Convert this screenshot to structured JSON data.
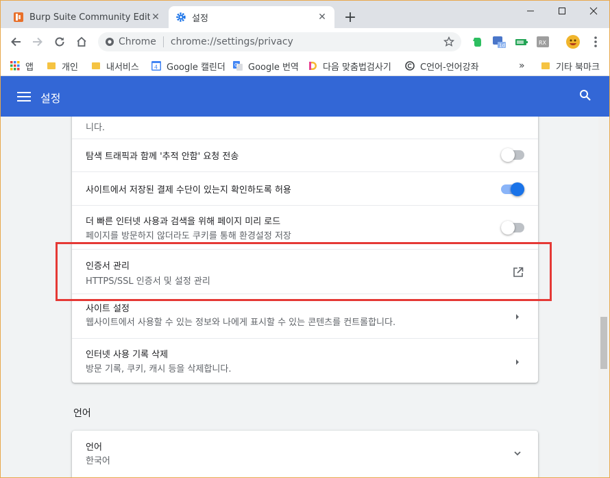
{
  "tabs": [
    {
      "title": "Burp Suite Community Edition",
      "icon": "burp-icon"
    },
    {
      "title": "설정",
      "icon": "gear-icon"
    }
  ],
  "toolbar": {
    "omnibox_label": "Chrome",
    "url": "chrome://settings/privacy"
  },
  "bookmarks": [
    {
      "label": "앱",
      "icon": "apps-icon"
    },
    {
      "label": "개인",
      "icon": "folder-icon"
    },
    {
      "label": "내서비스",
      "icon": "folder-icon"
    },
    {
      "label": "Google 캘린더",
      "icon": "calendar-icon",
      "badge": "4"
    },
    {
      "label": "Google 번역",
      "icon": "translate-icon"
    },
    {
      "label": "다음 맞춤법검사기",
      "icon": "daum-icon"
    },
    {
      "label": "C언어-언어강좌",
      "icon": "site-icon"
    },
    {
      "label": "기타 북마크",
      "icon": "folder-icon"
    }
  ],
  "header": {
    "title": "설정"
  },
  "privacy_card": {
    "partial_text": "니다.",
    "dnt_label": "탐색 트래픽과 함께 '추적 안함' 요청 전송",
    "dnt_enabled": false,
    "payment_label": "사이트에서 저장된 결제 수단이 있는지 확인하도록 허용",
    "payment_enabled": true,
    "preload_label": "더 빠른 인터넷 사용과 검색을 위해 페이지 미리 로드",
    "preload_sublabel": "페이지를 방문하지 않더라도 쿠키를 통해 환경설정 저장",
    "preload_enabled": false,
    "cert_label": "인증서 관리",
    "cert_sublabel": "HTTPS/SSL 인증서 및 설정 관리",
    "site_label": "사이트 설정",
    "site_sublabel": "웹사이트에서 사용할 수 있는 정보와 나에게 표시할 수 있는 콘텐츠를 컨트롤합니다.",
    "clear_label": "인터넷 사용 기록 삭제",
    "clear_sublabel": "방문 기록, 쿠키, 캐시 등을 삭제합니다."
  },
  "language_section": {
    "title": "언어",
    "row_label": "언어",
    "row_value": "한국어"
  },
  "colors": {
    "header": "#3367d6",
    "toggle_on": "#1a73e8",
    "highlight": "#e53935"
  }
}
